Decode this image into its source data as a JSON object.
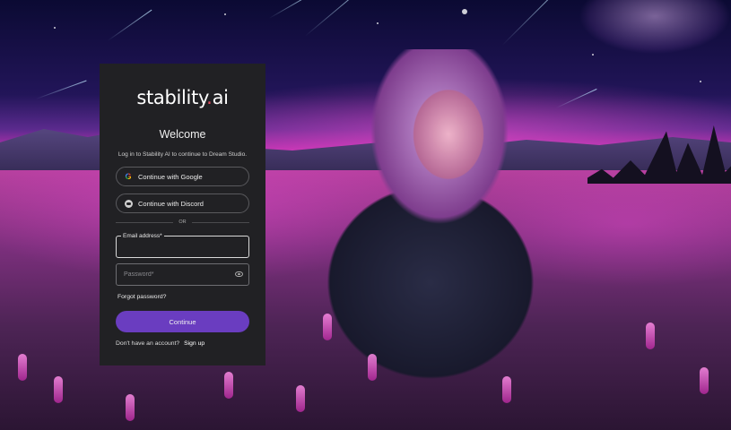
{
  "logo": {
    "text_main": "stability",
    "text_dot": ".",
    "text_end": "ai"
  },
  "welcome": {
    "title": "Welcome",
    "subtitle": "Log in to Stability AI to continue to Dream Studio."
  },
  "social": {
    "google": {
      "label": "Continue with Google",
      "icon": "google-icon"
    },
    "discord": {
      "label": "Continue with Discord",
      "icon": "discord-icon"
    }
  },
  "divider": {
    "text": "OR"
  },
  "form": {
    "email": {
      "label": "Email address*",
      "value": ""
    },
    "password": {
      "placeholder": "Password*",
      "value": ""
    },
    "forgot": "Forgot password?",
    "submit": "Continue"
  },
  "signup": {
    "prompt": "Don't have an account?",
    "link": "Sign up"
  },
  "colors": {
    "panel_bg": "#212124",
    "accent": "#6a3dc0",
    "logo_dot": "#e64b5f"
  }
}
